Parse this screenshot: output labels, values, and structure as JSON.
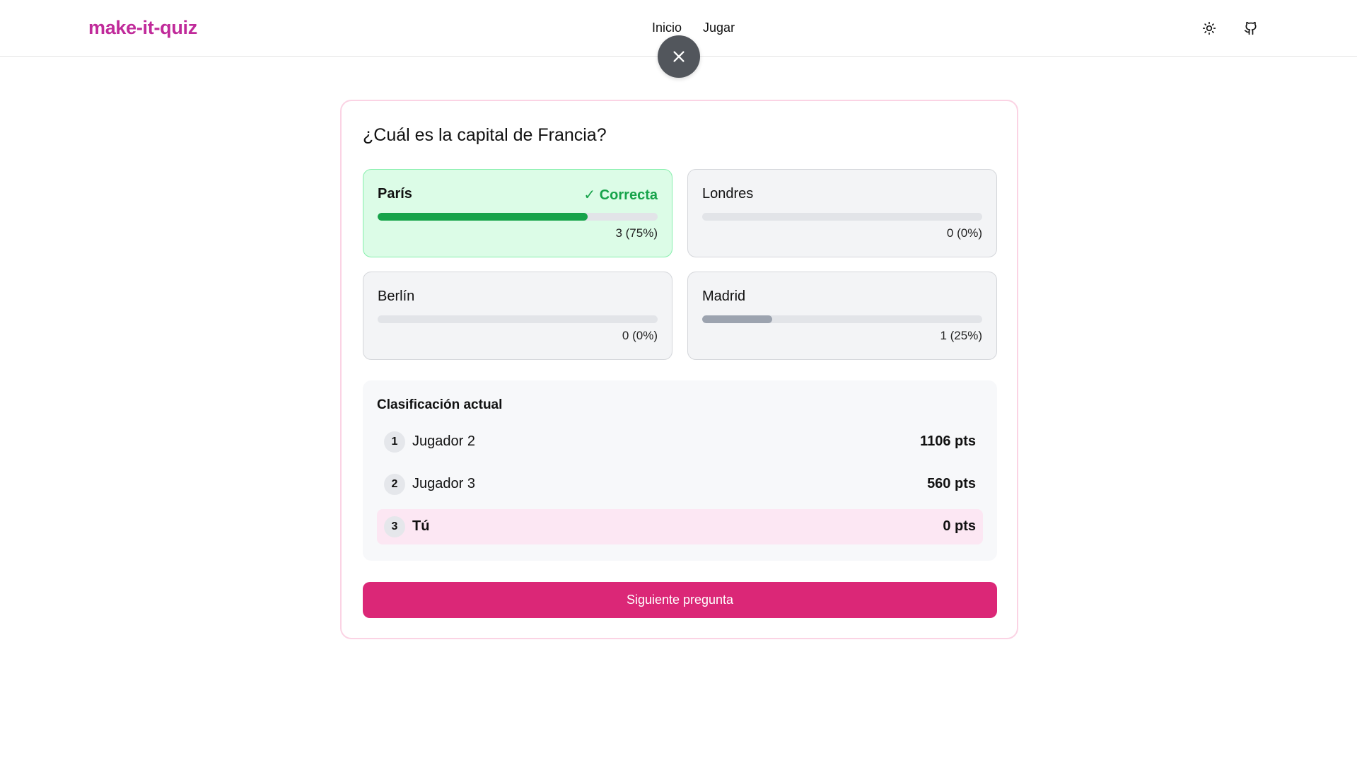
{
  "app": {
    "logo": "make-it-quiz"
  },
  "nav": {
    "items": [
      {
        "label": "Inicio"
      },
      {
        "label": "Jugar"
      }
    ]
  },
  "header_icons": [
    "sun-icon",
    "github-icon"
  ],
  "overlay": {
    "close_icon": "close-icon"
  },
  "question": {
    "text": "¿Cuál es la capital de Francia?"
  },
  "options": [
    {
      "label": "París",
      "correct": true,
      "badge": "✓ Correcta",
      "count_text": "3 (75%)",
      "percent": 75
    },
    {
      "label": "Londres",
      "correct": false,
      "badge": "",
      "count_text": "0 (0%)",
      "percent": 0
    },
    {
      "label": "Berlín",
      "correct": false,
      "badge": "",
      "count_text": "0 (0%)",
      "percent": 0
    },
    {
      "label": "Madrid",
      "correct": false,
      "badge": "",
      "count_text": "1 (25%)",
      "percent": 25
    }
  ],
  "leaderboard": {
    "title": "Clasificación actual",
    "rows": [
      {
        "rank": "1",
        "name": "Jugador 2",
        "points": "1106 pts",
        "is_me": false
      },
      {
        "rank": "2",
        "name": "Jugador 3",
        "points": "560 pts",
        "is_me": false
      },
      {
        "rank": "3",
        "name": "Tú",
        "points": "0 pts",
        "is_me": true
      }
    ]
  },
  "actions": {
    "next_label": "Siguiente pregunta"
  },
  "colors": {
    "brand": "#c02a9a",
    "accent": "#db2777",
    "correct": "#16a34a",
    "correct_bg": "#dcfce7",
    "me_bg": "#fce7f3"
  }
}
